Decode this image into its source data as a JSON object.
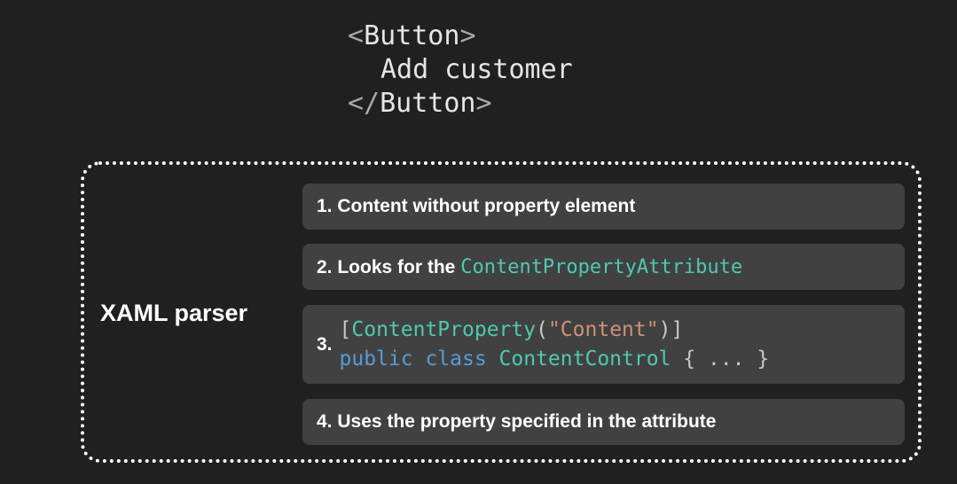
{
  "code_snippet": {
    "open_tag_bracket_open": "<",
    "open_tag_name": "Button",
    "open_tag_bracket_close": ">",
    "content_text": "Add customer",
    "close_tag_bracket_open": "</",
    "close_tag_name": "Button",
    "close_tag_bracket_close": ">"
  },
  "parser": {
    "label": "XAML parser",
    "steps": [
      {
        "number": "1.",
        "text": "Content without property element"
      },
      {
        "number": "2.",
        "text": "Looks for the",
        "code": "ContentPropertyAttribute"
      },
      {
        "number": "3.",
        "code_line1": {
          "open_bracket": "[",
          "attr": "ContentProperty",
          "paren_open": "(",
          "string": "\"Content\"",
          "paren_close": ")",
          "close_bracket": "]"
        },
        "code_line2": {
          "keywords": "public class",
          "type": "ContentControl",
          "body": "{ ... }"
        }
      },
      {
        "number": "4.",
        "text": "Uses the property specified in the attribute"
      }
    ]
  },
  "colors": {
    "background": "#202020",
    "step_background": "#414141",
    "type_teal": "#4ec9b0",
    "keyword_blue": "#569cd6",
    "string_orange": "#ce9178"
  }
}
